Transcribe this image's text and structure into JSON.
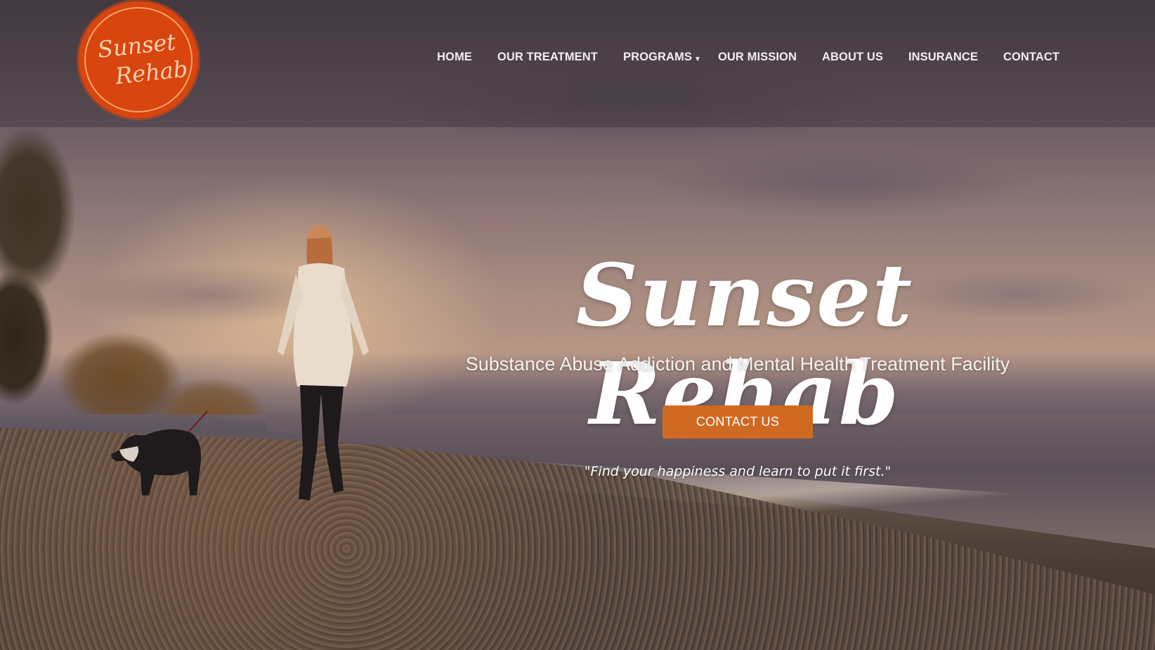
{
  "brand": {
    "logo_line1": "Sunset",
    "logo_line2": "Rehab",
    "logo_color": "#d9450f"
  },
  "nav": {
    "items": [
      {
        "label": "HOME"
      },
      {
        "label": "OUR TREATMENT"
      },
      {
        "label": "PROGRAMS",
        "has_dropdown": true,
        "dropdown_icon": "caret-down-icon"
      },
      {
        "label": "OUR MISSION"
      },
      {
        "label": "ABOUT US"
      },
      {
        "label": "INSURANCE"
      },
      {
        "label": "CONTACT"
      }
    ]
  },
  "hero": {
    "title": "Sunset Rehab",
    "subtitle": "Substance Abuse Addiction and Mental Health Treatment Facility",
    "cta_label": "CONTACT US",
    "cta_color": "#d06a22",
    "quote": "\"Find your happiness and learn to put it first.\""
  }
}
